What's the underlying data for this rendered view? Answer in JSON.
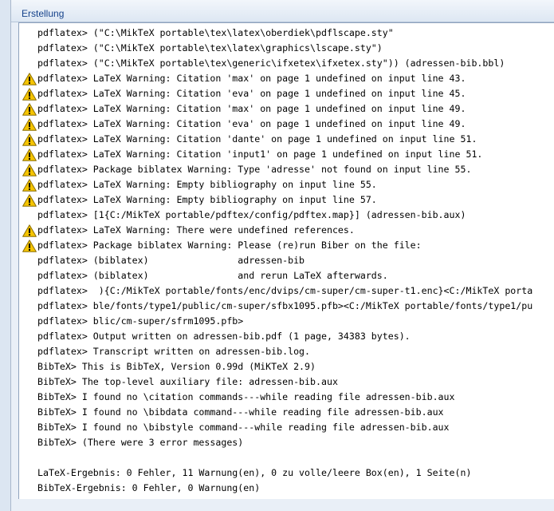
{
  "panel": {
    "title": "Erstellung"
  },
  "lines": [
    {
      "warn": false,
      "text": "pdflatex> (\"C:\\MikTeX portable\\tex\\latex\\oberdiek\\pdflscape.sty\""
    },
    {
      "warn": false,
      "text": "pdflatex> (\"C:\\MikTeX portable\\tex\\latex\\graphics\\lscape.sty\")"
    },
    {
      "warn": false,
      "text": "pdflatex> (\"C:\\MikTeX portable\\tex\\generic\\ifxetex\\ifxetex.sty\")) (adressen-bib.bbl)"
    },
    {
      "warn": true,
      "text": "pdflatex> LaTeX Warning: Citation 'max' on page 1 undefined on input line 43."
    },
    {
      "warn": true,
      "text": "pdflatex> LaTeX Warning: Citation 'eva' on page 1 undefined on input line 45."
    },
    {
      "warn": true,
      "text": "pdflatex> LaTeX Warning: Citation 'max' on page 1 undefined on input line 49."
    },
    {
      "warn": true,
      "text": "pdflatex> LaTeX Warning: Citation 'eva' on page 1 undefined on input line 49."
    },
    {
      "warn": true,
      "text": "pdflatex> LaTeX Warning: Citation 'dante' on page 1 undefined on input line 51."
    },
    {
      "warn": true,
      "text": "pdflatex> LaTeX Warning: Citation 'input1' on page 1 undefined on input line 51."
    },
    {
      "warn": true,
      "text": "pdflatex> Package biblatex Warning: Type 'adresse' not found on input line 55."
    },
    {
      "warn": true,
      "text": "pdflatex> LaTeX Warning: Empty bibliography on input line 55."
    },
    {
      "warn": true,
      "text": "pdflatex> LaTeX Warning: Empty bibliography on input line 57."
    },
    {
      "warn": false,
      "text": "pdflatex> [1{C:/MikTeX portable/pdftex/config/pdftex.map}] (adressen-bib.aux)"
    },
    {
      "warn": true,
      "text": "pdflatex> LaTeX Warning: There were undefined references."
    },
    {
      "warn": true,
      "text": "pdflatex> Package biblatex Warning: Please (re)run Biber on the file:"
    },
    {
      "warn": false,
      "text": "pdflatex> (biblatex)                adressen-bib"
    },
    {
      "warn": false,
      "text": "pdflatex> (biblatex)                and rerun LaTeX afterwards."
    },
    {
      "warn": false,
      "text": "pdflatex>  ){C:/MikTeX portable/fonts/enc/dvips/cm-super/cm-super-t1.enc}<C:/MikTeX porta"
    },
    {
      "warn": false,
      "text": "pdflatex> ble/fonts/type1/public/cm-super/sfbx1095.pfb><C:/MikTeX portable/fonts/type1/pu"
    },
    {
      "warn": false,
      "text": "pdflatex> blic/cm-super/sfrm1095.pfb>"
    },
    {
      "warn": false,
      "text": "pdflatex> Output written on adressen-bib.pdf (1 page, 34383 bytes)."
    },
    {
      "warn": false,
      "text": "pdflatex> Transcript written on adressen-bib.log."
    },
    {
      "warn": false,
      "text": "BibTeX> This is BibTeX, Version 0.99d (MiKTeX 2.9)"
    },
    {
      "warn": false,
      "text": "BibTeX> The top-level auxiliary file: adressen-bib.aux"
    },
    {
      "warn": false,
      "text": "BibTeX> I found no \\citation commands---while reading file adressen-bib.aux"
    },
    {
      "warn": false,
      "text": "BibTeX> I found no \\bibdata command---while reading file adressen-bib.aux"
    },
    {
      "warn": false,
      "text": "BibTeX> I found no \\bibstyle command---while reading file adressen-bib.aux"
    },
    {
      "warn": false,
      "text": "BibTeX> (There were 3 error messages)"
    },
    {
      "warn": false,
      "text": ""
    },
    {
      "warn": false,
      "text": "LaTeX-Ergebnis: 0 Fehler, 11 Warnung(en), 0 zu volle/leere Box(en), 1 Seite(n)"
    },
    {
      "warn": false,
      "text": "BibTeX-Ergebnis: 0 Fehler, 0 Warnung(en)"
    }
  ],
  "icons": {
    "warning": "warning-icon"
  },
  "colors": {
    "warning_fill": "#f5c400",
    "warning_stroke": "#8a6d00",
    "title": "#15428b"
  }
}
